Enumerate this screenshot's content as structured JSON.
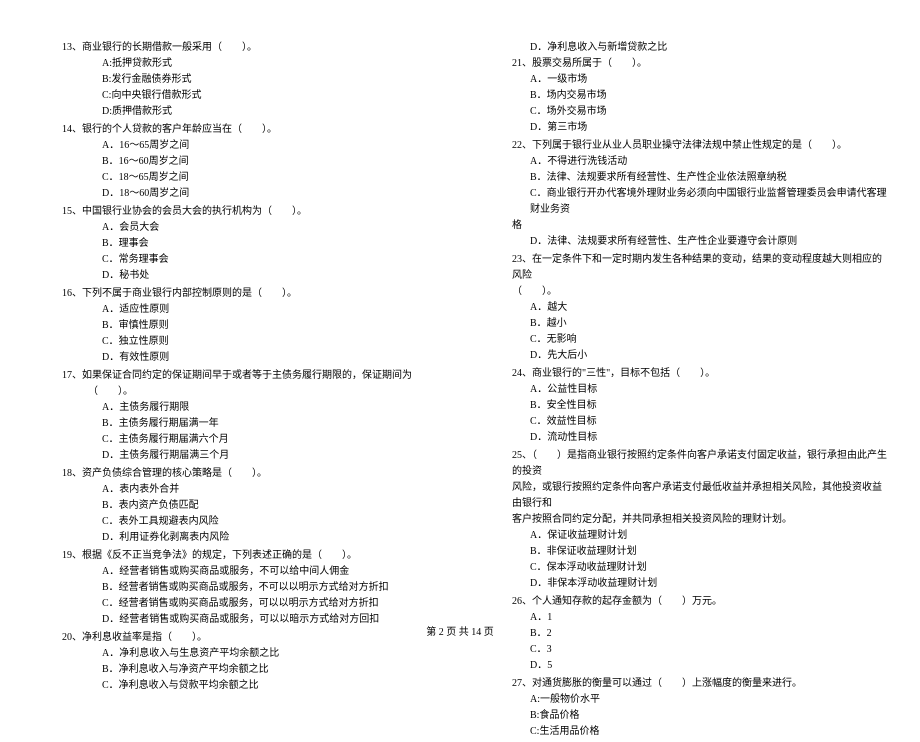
{
  "left": {
    "q13": {
      "stem": "13、商业银行的长期借款一般采用（　　）。",
      "a": "A:抵押贷款形式",
      "b": "B:发行金融债券形式",
      "c": "C:向中央银行借款形式",
      "d": "D:质押借款形式"
    },
    "q14": {
      "stem": "14、银行的个人贷款的客户年龄应当在（　　）。",
      "a": "A．16～65周岁之间",
      "b": "B．16～60周岁之间",
      "c": "C．18～65周岁之间",
      "d": "D．18～60周岁之间"
    },
    "q15": {
      "stem": "15、中国银行业协会的会员大会的执行机构为（　　）。",
      "a": "A．会员大会",
      "b": "B．理事会",
      "c": "C．常务理事会",
      "d": "D．秘书处"
    },
    "q16": {
      "stem": "16、下列不属于商业银行内部控制原则的是（　　）。",
      "a": "A．适应性原则",
      "b": "B．审慎性原则",
      "c": "C．独立性原则",
      "d": "D．有效性原则"
    },
    "q17": {
      "stem": "17、如果保证合同约定的保证期间早于或者等于主债务履行期限的，保证期间为（　　）。",
      "a": "A．主债务履行期限",
      "b": "B．主债务履行期届满一年",
      "c": "C．主债务履行期届满六个月",
      "d": "D．主债务履行期届满三个月"
    },
    "q18": {
      "stem": "18、资产负债综合管理的核心策略是（　　）。",
      "a": "A．表内表外合并",
      "b": "B．表内资产负债匹配",
      "c": "C．表外工具规避表内风险",
      "d": "D．利用证券化剥离表内风险"
    },
    "q19": {
      "stem": "19、根据《反不正当竞争法》的规定，下列表述正确的是（　　）。",
      "a": "A．经营者销售或购买商品或服务，不可以给中间人佣金",
      "b": "B．经营者销售或购买商品或服务，不可以以明示方式给对方折扣",
      "c": "C．经营者销售或购买商品或服务，可以以明示方式给对方折扣",
      "d": "D．经营者销售或购买商品或服务，可以以暗示方式给对方回扣"
    },
    "q20": {
      "stem": "20、净利息收益率是指（　　）。",
      "a": "A．净利息收入与生息资产平均余额之比",
      "b": "B．净利息收入与净资产平均余额之比",
      "c": "C．净利息收入与贷款平均余额之比"
    }
  },
  "right": {
    "q20d": "D．净利息收入与新增贷款之比",
    "q21": {
      "stem": "21、股票交易所属于（　　）。",
      "a": "A．一级市场",
      "b": "B．场内交易市场",
      "c": "C．场外交易市场",
      "d": "D．第三市场"
    },
    "q22": {
      "stem": "22、下列属于银行业从业人员职业操守法律法规中禁止性规定的是（　　）。",
      "a": "A．不得进行洗钱活动",
      "b": "B．法律、法规要求所有经营性、生产性企业依法照章纳税",
      "c": "C．商业银行开办代客境外理财业务必须向中国银行业监督管理委员会申请代客理财业务资",
      "c2": "格",
      "d": "D．法律、法规要求所有经营性、生产性企业要遵守会计原则"
    },
    "q23": {
      "stem": "23、在一定条件下和一定时期内发生各种结果的变动，结果的变动程度越大则相应的风险",
      "stem2": "（　　）。",
      "a": "A．越大",
      "b": "B．越小",
      "c": "C．无影响",
      "d": "D．先大后小"
    },
    "q24": {
      "stem": "24、商业银行的\"三性\"，目标不包括（　　）。",
      "a": "A．公益性目标",
      "b": "B．安全性目标",
      "c": "C．效益性目标",
      "d": "D．流动性目标"
    },
    "q25": {
      "stem": "25、（　　）是指商业银行按照约定条件向客户承诺支付固定收益，银行承担由此产生的投资",
      "stem2": "风险，或银行按照约定条件向客户承诺支付最低收益并承担相关风险，其他投资收益由银行和",
      "stem3": "客户按照合同约定分配，并共同承担相关投资风险的理财计划。",
      "a": "A．保证收益理财计划",
      "b": "B．非保证收益理财计划",
      "c": "C．保本浮动收益理财计划",
      "d": "D．非保本浮动收益理财计划"
    },
    "q26": {
      "stem": "26、个人通知存款的起存金额为（　　）万元。",
      "a": "A．1",
      "b": "B．2",
      "c": "C．3",
      "d": "D．5"
    },
    "q27": {
      "stem": "27、对通货膨胀的衡量可以通过（　　）上涨幅度的衡量来进行。",
      "a": "A:一般物价水平",
      "b": "B:食品价格",
      "c": "C:生活用品价格"
    }
  },
  "footer": "第 2 页 共 14 页"
}
